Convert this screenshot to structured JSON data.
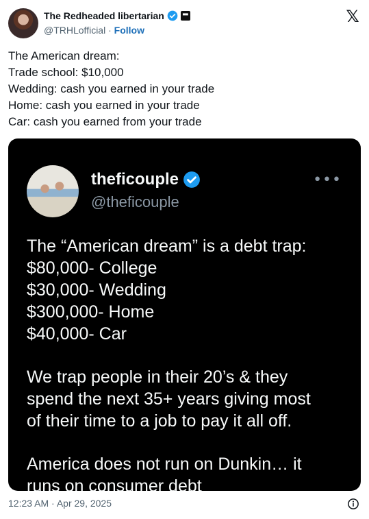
{
  "author": {
    "display_name": "The Redheaded libertarian",
    "handle": "@TRHLofficial",
    "separator": "·",
    "follow_label": "Follow"
  },
  "tweet_lines": [
    "The American dream:",
    "Trade school: $10,000",
    "Wedding: cash you earned in your trade",
    "Home: cash you earned in your trade",
    "Car: cash you earned from your trade"
  ],
  "embedded": {
    "display_name": "theficouple",
    "handle": "@theficouple",
    "more_label": "•••",
    "lines": [
      "The “American dream” is a debt trap:",
      "$80,000- College",
      "$30,000- Wedding",
      "$300,000- Home",
      "$40,000- Car",
      "",
      "We trap people in their 20’s & they",
      "spend the next 35+ years giving most",
      "of their time to a job to pay it all off.",
      "",
      "America does not run on Dunkin… it",
      "runs on consumer debt"
    ]
  },
  "footer": {
    "timestamp": "12:23 AM · Apr 29, 2025"
  },
  "colors": {
    "verified_blue": "#1d9bf0",
    "link_blue": "#1d6fb8",
    "text_dark": "#0f1419",
    "text_muted": "#536471"
  }
}
